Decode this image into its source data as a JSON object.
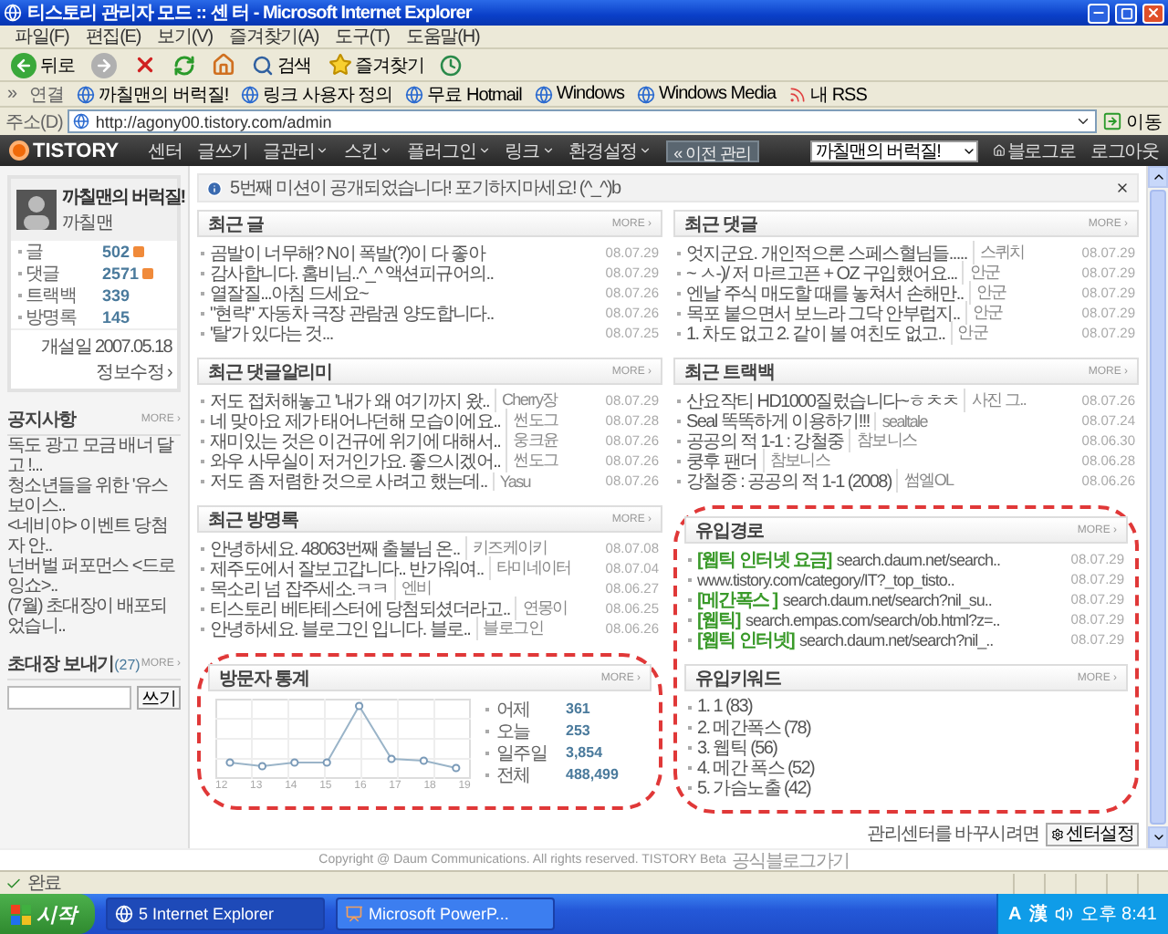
{
  "window": {
    "title": "티스토리 관리자 모드 :: 센 터 - Microsoft Internet Explorer"
  },
  "menu": [
    "파일(F)",
    "편집(E)",
    "보기(V)",
    "즐겨찾기(A)",
    "도구(T)",
    "도움말(H)"
  ],
  "toolbar": [
    {
      "kind": "back",
      "label": "뒤로"
    },
    {
      "kind": "forward"
    },
    {
      "kind": "stop"
    },
    {
      "kind": "refresh"
    },
    {
      "kind": "home"
    },
    {
      "kind": "search",
      "label": "검색"
    },
    {
      "kind": "favorites",
      "label": "즐겨찾기"
    },
    {
      "kind": "history"
    }
  ],
  "links": {
    "more": "»",
    "label": "연결",
    "items": [
      {
        "label": "까칠맨의 버럭질!",
        "kind": "page"
      },
      {
        "label": "링크 사용자 정의",
        "kind": "page"
      },
      {
        "label": "무료 Hotmail",
        "kind": "page"
      },
      {
        "label": "Windows",
        "kind": "page"
      },
      {
        "label": "Windows Media",
        "kind": "page"
      },
      {
        "label": "내 RSS",
        "kind": "rss"
      }
    ]
  },
  "address": {
    "label": "주소(D)",
    "value": "http://agony00.tistory.com/admin",
    "go": "이동"
  },
  "nav": {
    "logo": "TISTORY",
    "items": [
      {
        "label": "센터",
        "dropdown": false
      },
      {
        "label": "글쓰기",
        "dropdown": false
      },
      {
        "label": "글관리",
        "dropdown": true
      },
      {
        "label": "스킨",
        "dropdown": true
      },
      {
        "label": "플러그인",
        "dropdown": true
      },
      {
        "label": "링크",
        "dropdown": true
      },
      {
        "label": "환경설정",
        "dropdown": true
      }
    ],
    "previous": "« 이전 관리",
    "blog_select": "까칠맨의 버럭질!",
    "blog_link": "블로그로",
    "logout": "로그아웃"
  },
  "notice": {
    "text": "5번째 미션이 공개되었습니다! 포기하지마세요! (^_^)b"
  },
  "profile": {
    "name": "까칠맨의 버럭질!",
    "owner": "까칠맨",
    "stats": [
      {
        "label": "글",
        "value": "502",
        "new": true
      },
      {
        "label": "댓글",
        "value": "2571",
        "new": true
      },
      {
        "label": "트랙백",
        "value": "339",
        "new": false
      },
      {
        "label": "방명록",
        "value": "145",
        "new": false
      }
    ],
    "opened": "개설일 2007.05.18",
    "edit": "정보수정 ›"
  },
  "announcements": {
    "title": "공지사항",
    "more": "MORE ›",
    "items": [
      "독도 광고 모금 배너 달고 !...",
      "청소년들을 위한 '유스보이스..",
      "<네비야> 이벤트 당첨자 안..",
      "넌버벌 퍼포먼스 <드로잉쇼>..",
      "(7월) 초대장이 배포되었습니.."
    ]
  },
  "invite": {
    "title": "초대장 보내기",
    "count": "(27)",
    "more": "MORE ›",
    "button": "쓰기"
  },
  "columns": [
    [
      {
        "kind": "list",
        "title": "최근 글",
        "more": "MORE ›",
        "outlined": false,
        "rows": [
          {
            "text": "곰발이 너무해? N이 폭발(?)이 다 좋아",
            "date": "08.07.29"
          },
          {
            "text": "감사합니다. 홈비님..^_^ 액션피규어의..",
            "date": "08.07.29"
          },
          {
            "text": "열잘질...아침 드세요~",
            "date": "08.07.26"
          },
          {
            "text": "\"현략\" 자동차 극장 관람권 양도합니다..",
            "date": "08.07.26"
          },
          {
            "text": "'탈'가 있다는 것...",
            "date": "08.07.25"
          }
        ]
      },
      {
        "kind": "list",
        "title": "최근 댓글알리미",
        "more": "MORE ›",
        "outlined": false,
        "rows": [
          {
            "text": "저도 접처해놓고 '내가 왜 여기까지 왔..",
            "author": "Cherry장",
            "date": "08.07.29"
          },
          {
            "text": "네 맞아요 제가 태어나던해 모습이에요..",
            "author": "썬도그",
            "date": "08.07.28"
          },
          {
            "text": "재미있는 것은 이건규에 위기에 대해서..",
            "author": "웅크윤",
            "date": "08.07.26"
          },
          {
            "text": "와우 사무실이 저거인가요. 좋으시겠어..",
            "author": "썬도그",
            "date": "08.07.26"
          },
          {
            "text": "저도 좀 저렴한 것으로 사려고 했는데..",
            "author": "Yasu",
            "date": "08.07.26"
          }
        ]
      },
      {
        "kind": "list",
        "title": "최근 방명록",
        "more": "MORE ›",
        "outlined": false,
        "rows": [
          {
            "text": "안녕하세요. 48063번째 출불님 온..",
            "author": "키즈케이키",
            "date": "08.07.08"
          },
          {
            "text": "제주도에서 잘보고갑니다.. 반가워여..",
            "author": "타미네이터",
            "date": "08.07.04"
          },
          {
            "text": "목소리 넘 잡주세소.ㅋㅋ",
            "author": "엔비",
            "date": "08.06.27"
          },
          {
            "text": "티스토리 베타테스터에 당첨되셨더라고..",
            "author": "연몽이",
            "date": "08.06.25"
          },
          {
            "text": "안녕하세요. 블로그인 입니다. 블로..",
            "author": "블로그인",
            "date": "08.06.26"
          }
        ]
      },
      {
        "kind": "stats",
        "title": "방문자 통계",
        "more": "MORE ›",
        "outlined": true,
        "x_labels": [
          "12",
          "13",
          "14",
          "15",
          "16",
          "17",
          "18",
          "19"
        ],
        "stats": [
          {
            "label": "어제",
            "value": "361"
          },
          {
            "label": "오늘",
            "value": "253"
          },
          {
            "label": "일주일",
            "value": "3,854"
          },
          {
            "label": "전체",
            "value": "488,499"
          }
        ]
      }
    ],
    [
      {
        "kind": "list",
        "title": "최근 댓글",
        "more": "MORE ›",
        "outlined": false,
        "rows": [
          {
            "text": "엇지군요. 개인적으론 스페스혈님들.....",
            "author": "스퀴치",
            "date": "08.07.29"
          },
          {
            "text": "~ ㅅ-)/ 저 마르고픈 + OZ 구입했어요...",
            "author": "안군",
            "date": "08.07.29"
          },
          {
            "text": "엔날 주식 매도할 때를 놓쳐서 손해만..",
            "author": "안군",
            "date": "08.07.29"
          },
          {
            "text": "목포 붙으면서 보느라 그닥 안부럽지..",
            "author": "안군",
            "date": "08.07.29"
          },
          {
            "text": "1. 차도 없고 2. 같이 볼 여친도 없고..",
            "author": "안군",
            "date": "08.07.29"
          }
        ]
      },
      {
        "kind": "list",
        "title": "최근 트랙백",
        "more": "MORE ›",
        "outlined": false,
        "rows": [
          {
            "text": "산요작티 HD1000질렀습니다~ㅎㅊㅊ",
            "author": "사진 그..",
            "date": "08.07.26"
          },
          {
            "text": "Seal 똑똑하게 이용하기!!!",
            "author": "sealtale",
            "date": "08.07.24"
          },
          {
            "text": "공공의 적 1-1 : 강철중",
            "author": "참보니스",
            "date": "08.06.30"
          },
          {
            "text": "쿵후 팬더",
            "author": "참보니스",
            "date": "08.06.28"
          },
          {
            "text": "강철중 : 공공의 적 1-1 (2008)",
            "author": "썸엘OL",
            "date": "08.06.26"
          }
        ]
      },
      {
        "kind": "referrer",
        "title": "유입경로",
        "more": "MORE ›",
        "outlined": true,
        "rows": [
          {
            "keyword": "[웹틱 인터넷 요금]",
            "url": "search.daum.net/search..",
            "date": "08.07.29"
          },
          {
            "url": "www.tistory.com/category/IT?_top_tisto..",
            "date": "08.07.29"
          },
          {
            "keyword": "[메간폭스 ]",
            "url": "search.daum.net/search?nil_su..",
            "date": "08.07.29"
          },
          {
            "keyword": "[웹틱]",
            "url": "search.empas.com/search/ob.html?z=..",
            "date": "08.07.29"
          },
          {
            "keyword": "[웹틱 인터넷]",
            "url": "search.daum.net/search?nil_..",
            "date": "08.07.29"
          }
        ]
      },
      {
        "kind": "keywords",
        "title": "유입키워드",
        "more": "MORE ›",
        "outlined": true,
        "rows": [
          {
            "text": "1. 1 (83)"
          },
          {
            "text": "2. 메간폭스 (78)"
          },
          {
            "text": "3. 웹틱 (56)"
          },
          {
            "text": "4. 메간 폭스 (52)"
          },
          {
            "text": "5. 가슴노출 (42)"
          }
        ]
      }
    ]
  ],
  "center_setting": {
    "hint": "관리센터를 바꾸시려면",
    "button": "센터설정"
  },
  "copyright": {
    "text": "Copyright @ Daum Communications. All rights reserved. TISTORY Beta",
    "link": "공식블로그가기"
  },
  "status_bar": {
    "text": "완료"
  },
  "taskbar": {
    "start": "시작",
    "tasks": [
      {
        "label": "5 Internet Explorer",
        "kind": "browser",
        "selected": true
      },
      {
        "label": "Microsoft PowerP...",
        "kind": "slides",
        "selected": false
      }
    ],
    "ime": [
      "A",
      "漢"
    ],
    "time": "오후 8:41"
  }
}
